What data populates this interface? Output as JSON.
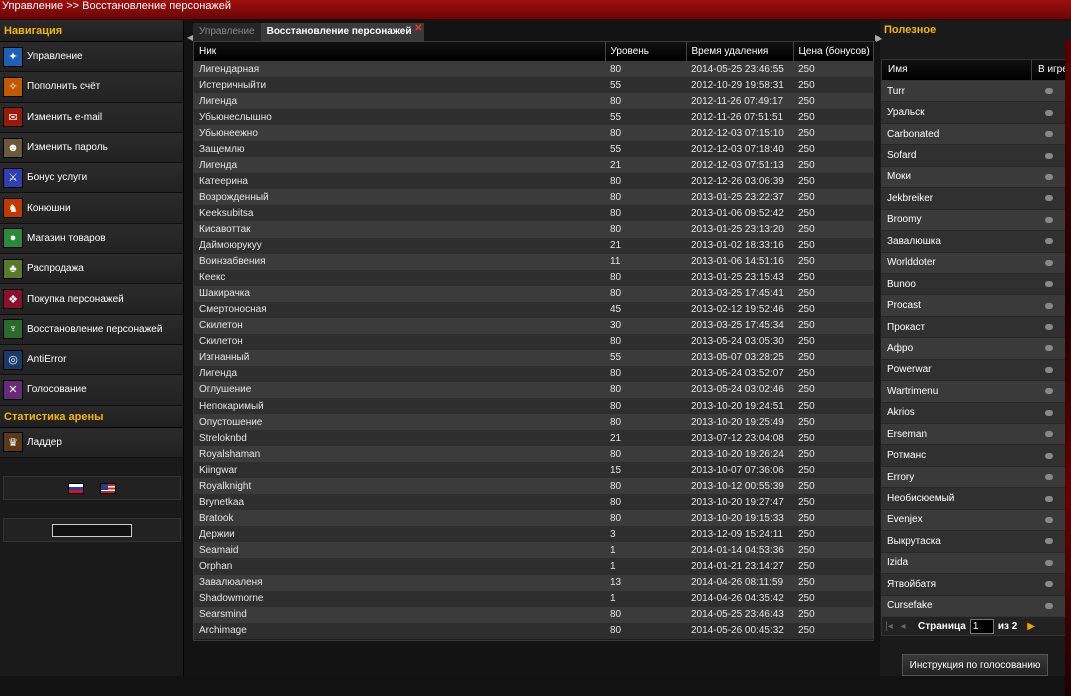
{
  "breadcrumb": "Управление >> Восстановление персонажей",
  "nav": {
    "title": "Навигация",
    "items": [
      {
        "label": "Управление",
        "icon": "control-icon",
        "color": "#1f5fb5",
        "glyph": "✦"
      },
      {
        "label": "Пополнить счёт",
        "icon": "replenish-icon",
        "color": "#c45800",
        "glyph": "✧"
      },
      {
        "label": "Изменить e-mail",
        "icon": "email-icon",
        "color": "#9a1a0a",
        "glyph": "✉"
      },
      {
        "label": "Изменить пароль",
        "icon": "password-icon",
        "color": "#6a5a3a",
        "glyph": "☻"
      },
      {
        "label": "Бонус услуги",
        "icon": "bonus-icon",
        "color": "#3040b0",
        "glyph": "⚔"
      },
      {
        "label": "Конюшни",
        "icon": "stables-icon",
        "color": "#c03a00",
        "glyph": "♞"
      },
      {
        "label": "Магазин товаров",
        "icon": "shop-icon",
        "color": "#2a8a3a",
        "glyph": "●"
      },
      {
        "label": "Распродажа",
        "icon": "sale-icon",
        "color": "#5a7a2a",
        "glyph": "♣"
      },
      {
        "label": "Покупка персонажей",
        "icon": "buy-character-icon",
        "color": "#8a1030",
        "glyph": "❖"
      },
      {
        "label": "Восстановление персонажей",
        "icon": "restore-character-icon",
        "color": "#2a6a2a",
        "glyph": "♆"
      },
      {
        "label": "AntiError",
        "icon": "antierror-icon",
        "color": "#1a3a6a",
        "glyph": "◎"
      },
      {
        "label": "Голосование",
        "icon": "vote-icon",
        "color": "#6a2a7a",
        "glyph": "✕"
      }
    ]
  },
  "arena": {
    "title": "Статистика арены",
    "items": [
      {
        "label": "Ладдер",
        "icon": "ladder-icon",
        "color": "#5a3a1a",
        "glyph": "♛"
      }
    ]
  },
  "tabs": [
    {
      "label": "Управление",
      "active": false
    },
    {
      "label": "Восстановление персонажей",
      "active": true
    }
  ],
  "table": {
    "columns": [
      "Ник",
      "Уровень",
      "Время удаления",
      "Цена (бонусов)"
    ],
    "rows": [
      [
        "Лигендарная",
        "80",
        "2014-05-25 23:46:55",
        "250"
      ],
      [
        "Истеричныйти",
        "55",
        "2012-10-29 19:58:31",
        "250"
      ],
      [
        "Лигенда",
        "80",
        "2012-11-26 07:49:17",
        "250"
      ],
      [
        "Убьюнеслышно",
        "55",
        "2012-11-26 07:51:51",
        "250"
      ],
      [
        "Убьюнеежно",
        "80",
        "2012-12-03 07:15:10",
        "250"
      ],
      [
        "Защемлю",
        "55",
        "2012-12-03 07:18:40",
        "250"
      ],
      [
        "Лигенда",
        "21",
        "2012-12-03 07:51:13",
        "250"
      ],
      [
        "Катеерина",
        "80",
        "2012-12-26 03:06:39",
        "250"
      ],
      [
        "Возрожденный",
        "80",
        "2013-01-25 23:22:37",
        "250"
      ],
      [
        "Keeksubitsa",
        "80",
        "2013-01-06 09:52:42",
        "250"
      ],
      [
        "Кисавоттак",
        "80",
        "2013-01-25 23:13:20",
        "250"
      ],
      [
        "Даймоюрукуу",
        "21",
        "2013-01-02 18:33:16",
        "250"
      ],
      [
        "Воинзабвения",
        "11",
        "2013-01-06 14:51:16",
        "250"
      ],
      [
        "Кеекс",
        "80",
        "2013-01-25 23:15:43",
        "250"
      ],
      [
        "Шакирачка",
        "80",
        "2013-03-25 17:45:41",
        "250"
      ],
      [
        "Смертоносная",
        "45",
        "2013-02-12 19:52:46",
        "250"
      ],
      [
        "Скилетон",
        "30",
        "2013-03-25 17:45:34",
        "250"
      ],
      [
        "Скилетон",
        "80",
        "2013-05-24 03:05:30",
        "250"
      ],
      [
        "Изгнанный",
        "55",
        "2013-05-07 03:28:25",
        "250"
      ],
      [
        "Лигенда",
        "80",
        "2013-05-24 03:52:07",
        "250"
      ],
      [
        "Оглушение",
        "80",
        "2013-05-24 03:02:46",
        "250"
      ],
      [
        "Непокаримый",
        "80",
        "2013-10-20 19:24:51",
        "250"
      ],
      [
        "Опустошение",
        "80",
        "2013-10-20 19:25:49",
        "250"
      ],
      [
        "Streloknbd",
        "21",
        "2013-07-12 23:04:08",
        "250"
      ],
      [
        "Royalshaman",
        "80",
        "2013-10-20 19:26:24",
        "250"
      ],
      [
        "Kiingwar",
        "15",
        "2013-10-07 07:36:06",
        "250"
      ],
      [
        "Royalknight",
        "80",
        "2013-10-12 00:55:39",
        "250"
      ],
      [
        "Brynetkaa",
        "80",
        "2013-10-20 19:27:47",
        "250"
      ],
      [
        "Bratook",
        "80",
        "2013-10-20 19:15:33",
        "250"
      ],
      [
        "Держии",
        "3",
        "2013-12-09 15:24:11",
        "250"
      ],
      [
        "Seamaid",
        "1",
        "2014-01-14 04:53:36",
        "250"
      ],
      [
        "Orphan",
        "1",
        "2014-01-21 23:14:27",
        "250"
      ],
      [
        "Завалюаленя",
        "13",
        "2014-04-26 08:11:59",
        "250"
      ],
      [
        "Shadowmorne",
        "1",
        "2014-04-26 04:35:42",
        "250"
      ],
      [
        "Searsmind",
        "80",
        "2014-05-25 23:46:43",
        "250"
      ],
      [
        "Archimage",
        "80",
        "2014-05-26 00:45:32",
        "250"
      ]
    ]
  },
  "useful": {
    "title": "Полезное",
    "columns": [
      "Имя",
      "В игре"
    ],
    "players": [
      "Turr",
      "Уральск",
      "Carbonated",
      "Sofard",
      "Моки",
      "Jekbreiker",
      "Broomy",
      "Завалюшка",
      "Worlddoter",
      "Bunoo",
      "Procast",
      "Прокаст",
      "Афро",
      "Powerwar",
      "Wartrimenu",
      "Akrios",
      "Erseman",
      "Ротманс",
      "Errory",
      "Необисюемый",
      "Evenjex",
      "Выкрутаска",
      "Izida",
      "Ятвойбатя",
      "Cursefake"
    ],
    "pager": {
      "label": "Страница",
      "page": "1",
      "of": "из 2"
    },
    "vote_button": "Инструкция по голосованию"
  }
}
